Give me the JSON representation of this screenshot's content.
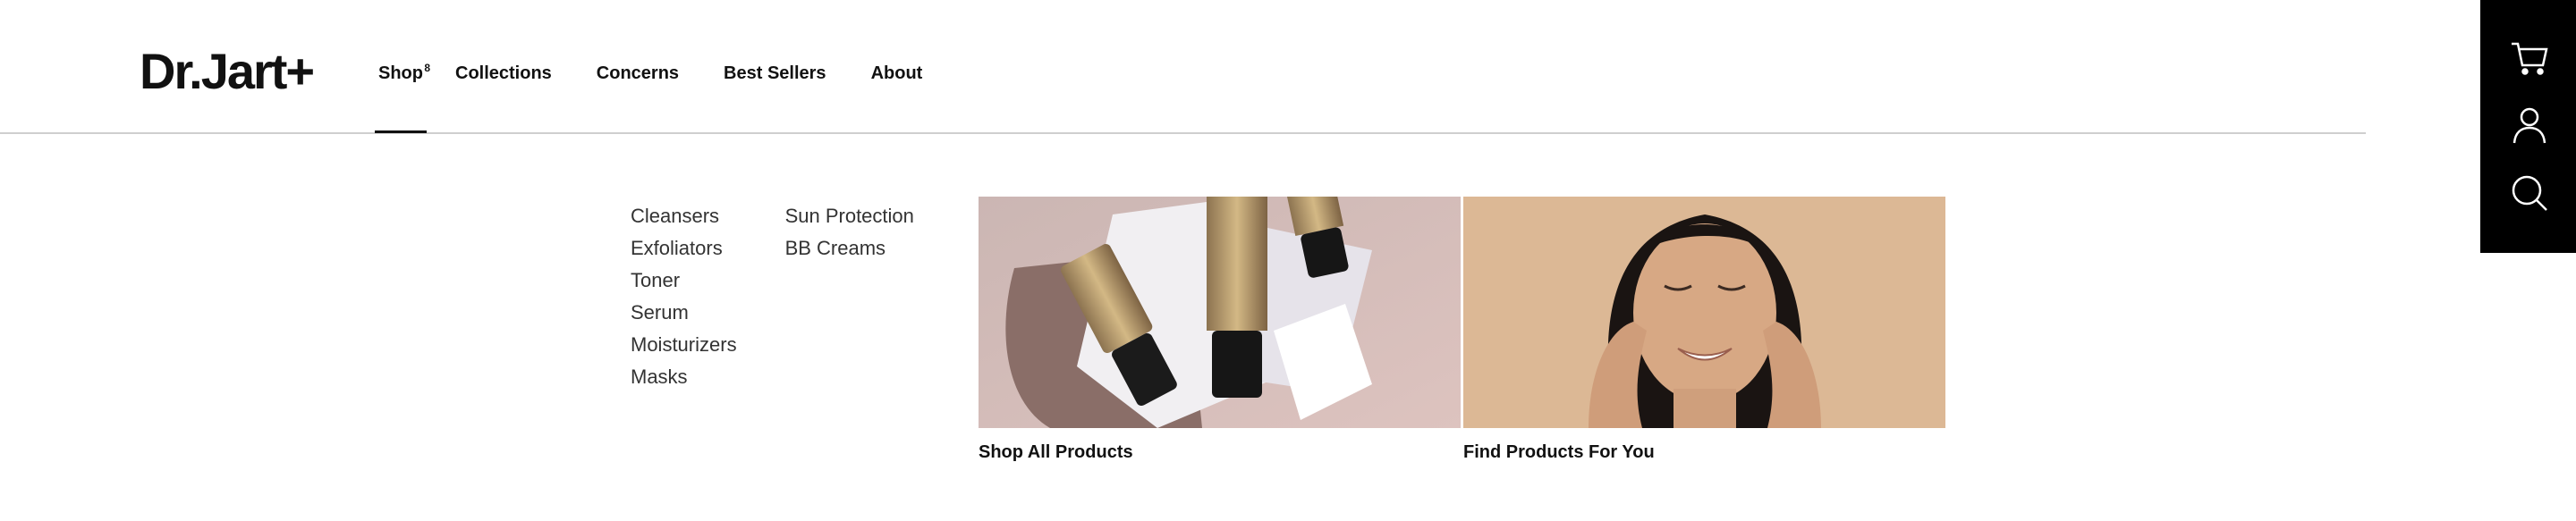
{
  "brand": {
    "logo_text": "Dr.Jart+"
  },
  "nav": {
    "items": [
      {
        "label": "Shop",
        "badge": "8"
      },
      {
        "label": "Collections"
      },
      {
        "label": "Concerns"
      },
      {
        "label": "Best Sellers"
      },
      {
        "label": "About"
      }
    ]
  },
  "utility": {
    "icons": [
      "cart-icon",
      "account-icon",
      "search-icon"
    ]
  },
  "menu": {
    "columns": [
      [
        "Cleansers",
        "Exfoliators",
        "Toner",
        "Serum",
        "Moisturizers",
        "Masks"
      ],
      [
        "Sun Protection",
        "BB Creams"
      ]
    ]
  },
  "promos": [
    {
      "label": "Shop All Products",
      "image": "bb-cream-tubes-photo"
    },
    {
      "label": "Find Products For You",
      "image": "smiling-woman-photo"
    }
  ],
  "colors": {
    "background": "#ffffff",
    "text": "#111111",
    "util_bar": "#000000",
    "divider": "#cfcfcf"
  }
}
